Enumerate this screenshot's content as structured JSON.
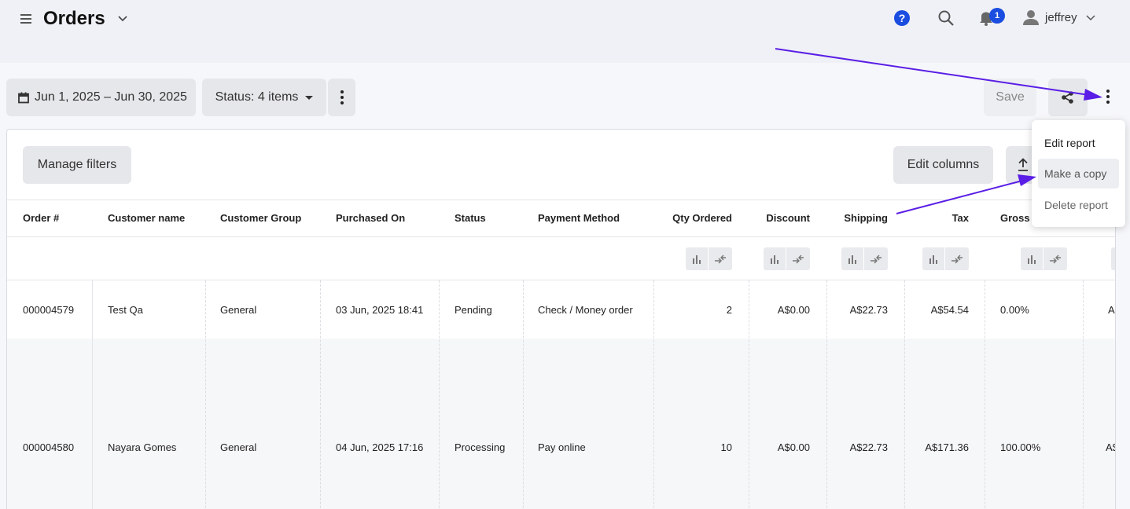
{
  "header": {
    "title": "Orders",
    "help_label": "?",
    "notification_count": "1",
    "user_name": "jeffrey"
  },
  "toolbar": {
    "date_range": "Jun 1, 2025 – Jun 30, 2025",
    "status_filter": "Status: 4 items",
    "save_label": "Save"
  },
  "report": {
    "manage_filters_label": "Manage filters",
    "edit_columns_label": "Edit columns"
  },
  "menu": {
    "items": [
      {
        "label": "Edit report"
      },
      {
        "label": "Make a copy"
      },
      {
        "label": "Delete report"
      }
    ]
  },
  "table": {
    "columns": [
      "Order #",
      "Customer name",
      "Customer Group",
      "Purchased On",
      "Status",
      "Payment Method",
      "Qty Ordered",
      "Discount",
      "Shipping",
      "Tax",
      "Gross"
    ],
    "rows": [
      {
        "order": "000004579",
        "customer": "Test Qa",
        "group": "General",
        "purchased": "03 Jun, 2025 18:41",
        "status": "Pending",
        "payment": "Check / Money order",
        "qty": "2",
        "discount": "A$0.00",
        "shipping": "A$22.73",
        "tax": "A$54.54",
        "gross": "0.00%",
        "overflow": "A"
      },
      {
        "order": "000004580",
        "customer": "Nayara Gomes",
        "group": "General",
        "purchased": "04 Jun, 2025 17:16",
        "status": "Processing",
        "payment": "Pay online",
        "qty": "10",
        "discount": "A$0.00",
        "shipping": "A$22.73",
        "tax": "A$171.36",
        "gross": "100.00%",
        "overflow": "A$"
      }
    ]
  },
  "colors": {
    "accent": "#1a4de0",
    "annotation_arrow": "#5a1ee6"
  }
}
